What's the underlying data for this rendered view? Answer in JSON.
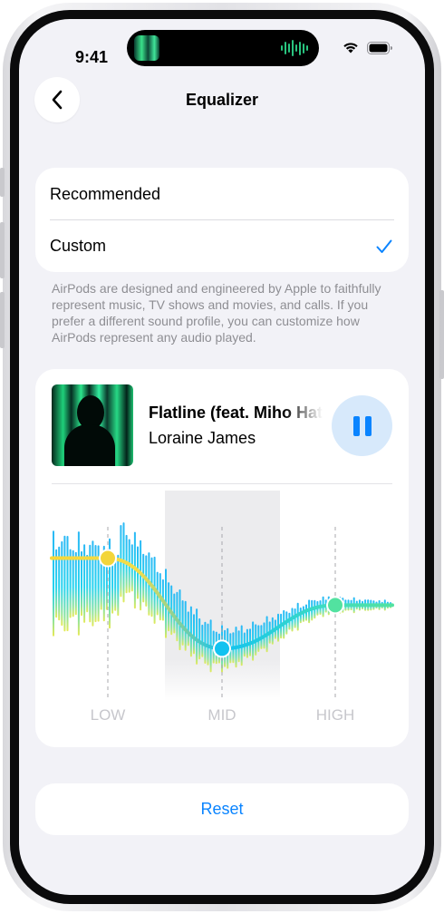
{
  "status": {
    "time": "9:41"
  },
  "nav": {
    "title": "Equalizer",
    "back_icon": "chevron-left-icon"
  },
  "options": [
    {
      "label": "Recommended",
      "selected": false
    },
    {
      "label": "Custom",
      "selected": true
    }
  ],
  "footnote": "AirPods are designed and engineered by Apple to faithfully represent music, TV shows and movies, and calls. If you prefer a different sound profile, you can customize how AirPods represent any audio played.",
  "now_playing": {
    "title": "Flatline (feat. Miho Hatori)",
    "artist": "Loraine James",
    "control_icon": "pause-icon"
  },
  "equalizer": {
    "bands": [
      {
        "label": "LOW",
        "level": 0.82
      },
      {
        "label": "MID",
        "level": 0.3
      },
      {
        "label": "HIGH",
        "level": 0.55
      }
    ]
  },
  "reset_label": "Reset",
  "colors": {
    "accent": "#0A84FF",
    "background": "#F2F2F7",
    "eq_low": "#F5D83A",
    "eq_mid": "#12C2F0",
    "eq_high": "#52E2A0"
  }
}
